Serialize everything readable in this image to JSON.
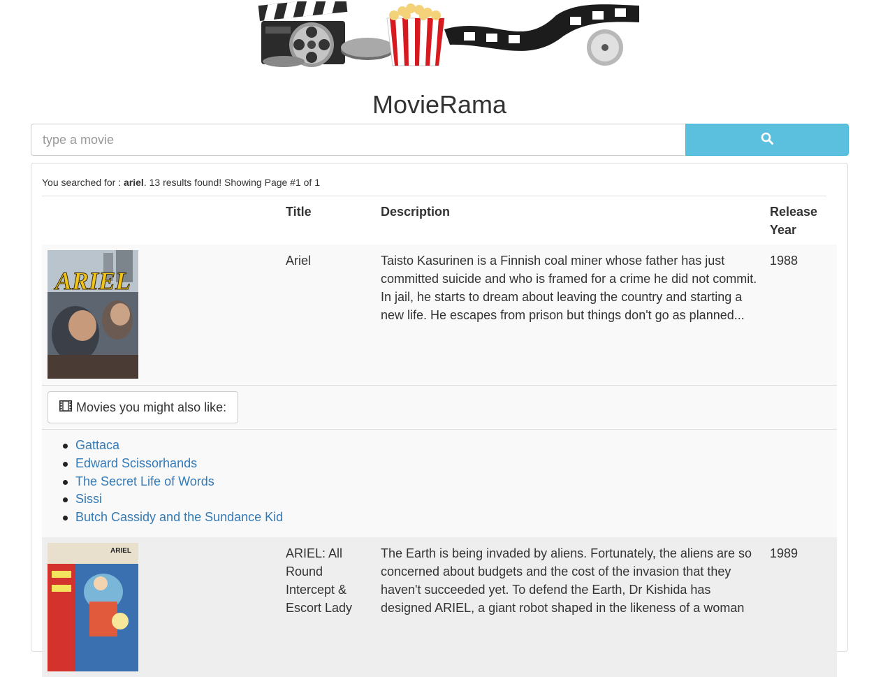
{
  "app": {
    "title": "MovieRama"
  },
  "search": {
    "placeholder": "type a movie",
    "value": "",
    "button_icon": "search-icon"
  },
  "results": {
    "prefix": "You searched for : ",
    "query": "ariel",
    "suffix": ". 13 results found! Showing Page #1 of 1"
  },
  "table": {
    "headers": {
      "title": "Title",
      "description": "Description",
      "release_line1": "Release",
      "release_line2": "Year"
    },
    "movies": [
      {
        "title": "Ariel",
        "description": "Taisto Kasurinen is a Finnish coal miner whose father has just committed suicide and who is framed for a crime he did not commit. In jail, he starts to dream about leaving the country and starting a new life. He escapes from prison but things don't go as planned...",
        "year": "1988",
        "poster_text": "ARIEL"
      },
      {
        "title": "ARIEL: All Round Intercept & Escort Lady",
        "description": "The Earth is being invaded by aliens. Fortunately, the aliens are so concerned about budgets and the cost of the invasion that they haven't succeeded yet. To defend the Earth, Dr Kishida has designed ARIEL, a giant robot shaped in the likeness of a woman",
        "year": "1989",
        "poster_text": "ARIEL"
      }
    ]
  },
  "suggestions": {
    "button_label": "Movies you might also like:",
    "button_icon": "film-icon",
    "items": [
      "Gattaca",
      "Edward Scissorhands",
      "The Secret Life of Words",
      "Sissi",
      "Butch Cassidy and the Sundance Kid"
    ]
  },
  "colors": {
    "search_button": "#5bc0de",
    "link": "#337ab7",
    "row_alt": "#eeeeee"
  }
}
